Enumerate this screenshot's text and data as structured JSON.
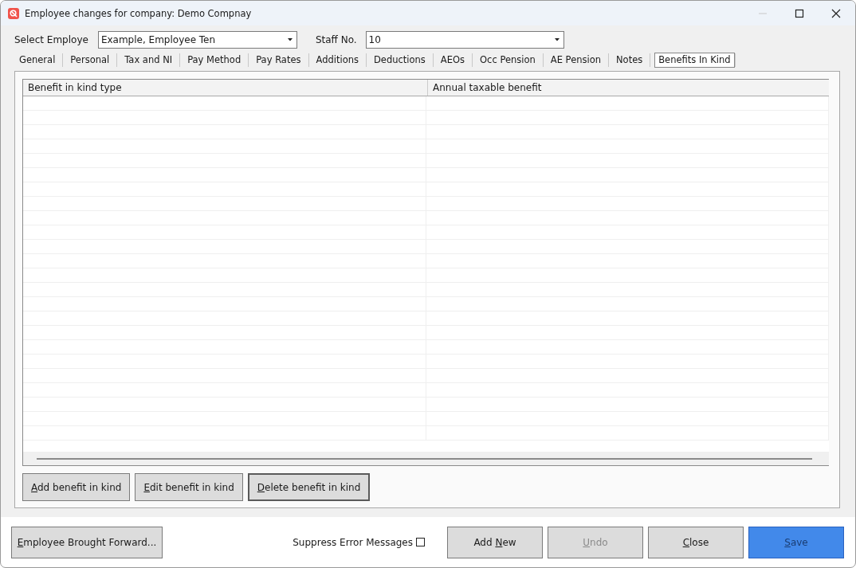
{
  "window": {
    "title": "Employee changes for company: Demo Compnay"
  },
  "employee_select": {
    "label": "Select Employe",
    "value": "Example, Employee Ten"
  },
  "staff_select": {
    "label": "Staff No.",
    "value": "10"
  },
  "tabs": [
    {
      "label": "General",
      "selected": false
    },
    {
      "label": "Personal",
      "selected": false
    },
    {
      "label": "Tax and NI",
      "selected": false
    },
    {
      "label": "Pay Method",
      "selected": false
    },
    {
      "label": "Pay Rates",
      "selected": false
    },
    {
      "label": "Additions",
      "selected": false
    },
    {
      "label": "Deductions",
      "selected": false
    },
    {
      "label": "AEOs",
      "selected": false
    },
    {
      "label": "Occ Pension",
      "selected": false
    },
    {
      "label": "AE Pension",
      "selected": false
    },
    {
      "label": "Notes",
      "selected": false
    },
    {
      "label": "Benefits In Kind",
      "selected": true
    }
  ],
  "table": {
    "columns": [
      "Benefit in kind type",
      "Annual taxable benefit"
    ]
  },
  "table_buttons": [
    {
      "parts": [
        {
          "text": "A",
          "underlined": true
        },
        {
          "text": "dd benefit in kind",
          "underlined": false
        }
      ],
      "focused": false
    },
    {
      "parts": [
        {
          "text": "E",
          "underlined": true
        },
        {
          "text": "dit benefit in kind",
          "underlined": false
        }
      ],
      "focused": false
    },
    {
      "parts": [
        {
          "text": "D",
          "underlined": true
        },
        {
          "text": "elete benefit in kind",
          "underlined": false
        }
      ],
      "focused": true
    }
  ],
  "brought_forward_button": {
    "parts": [
      {
        "text": "E",
        "underlined": true
      },
      {
        "text": "mployee Brought Forward...",
        "underlined": false
      }
    ]
  },
  "suppress_errors": {
    "label": "Suppress Error Messages",
    "checked": false
  },
  "footer_buttons": [
    {
      "kind": "normal",
      "disabled": false,
      "parts": [
        {
          "text": "Add ",
          "underlined": false
        },
        {
          "text": "N",
          "underlined": true
        },
        {
          "text": "ew",
          "underlined": false
        }
      ]
    },
    {
      "kind": "normal",
      "disabled": true,
      "parts": [
        {
          "text": "U",
          "underlined": true
        },
        {
          "text": "ndo",
          "underlined": false
        }
      ]
    },
    {
      "kind": "normal",
      "disabled": false,
      "parts": [
        {
          "text": "C",
          "underlined": true
        },
        {
          "text": "lose",
          "underlined": false
        }
      ]
    },
    {
      "kind": "primary",
      "disabled": false,
      "parts": [
        {
          "text": "S",
          "underlined": true
        },
        {
          "text": "ave",
          "underlined": false
        }
      ]
    }
  ]
}
